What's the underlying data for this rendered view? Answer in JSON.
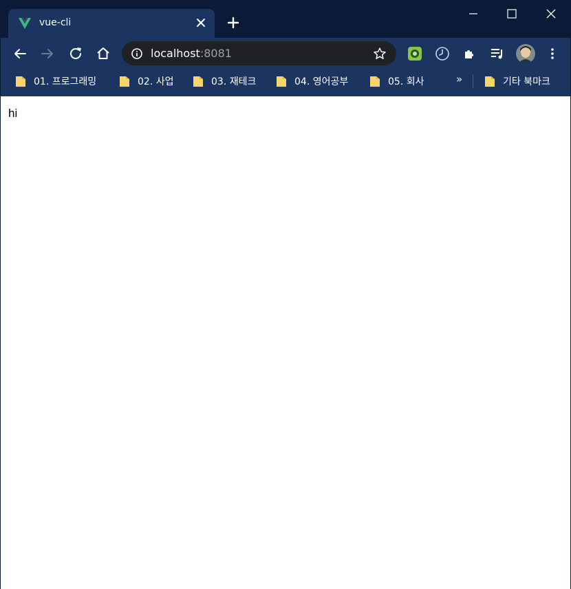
{
  "tab": {
    "title": "vue-cli",
    "favicon": "vue-logo-icon"
  },
  "address_bar": {
    "host": "localhost",
    "port": ":8081"
  },
  "bookmarks": [
    {
      "label": "01. 프로그래밍"
    },
    {
      "label": "02. 사업"
    },
    {
      "label": "03. 재테크"
    },
    {
      "label": "04. 영어공부"
    },
    {
      "label": "05. 회사"
    }
  ],
  "bookmarks_overflow": "»",
  "other_bookmarks": "기타 북마크",
  "page": {
    "text": "hi"
  },
  "colors": {
    "tabstrip": "#0b1a36",
    "toolbar": "#1c3560",
    "omnibox": "#202124",
    "vue_green": "#41b883"
  }
}
